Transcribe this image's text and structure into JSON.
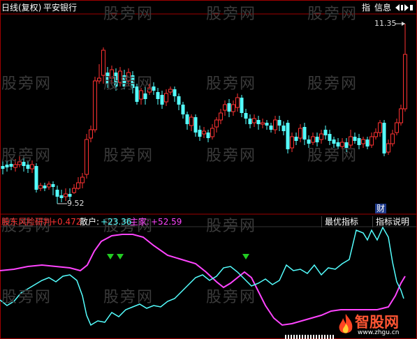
{
  "header": {
    "period_label": "日线(复权)",
    "stock_name": "平安银行",
    "btn_indicator": "指",
    "btn_info": "信息",
    "nav_icon": "speaker-arrows-icon"
  },
  "price_panel": {
    "high_label": "11.35",
    "low_label": "9.52",
    "cai_badge": "财"
  },
  "indicator_panel": {
    "name": "股东风险研判",
    "value1": "+0.472",
    "retail_label": "散户:",
    "retail_value": "+23.36",
    "main_label": "主家:",
    "main_value": "+52.59",
    "best_btn": "最优指标",
    "explain_btn": "指标说明"
  },
  "watermark": {
    "text": "股旁网",
    "logo_text": "智股网",
    "logo_url": "www.zhgu.cn"
  },
  "colors": {
    "up": "#ff3232",
    "down": "#54ffff",
    "retail_line": "#54ffff",
    "main_line": "#ff44ff",
    "marker": "#22cc22",
    "grid": "#a00000",
    "text": "#dddddd"
  }
}
